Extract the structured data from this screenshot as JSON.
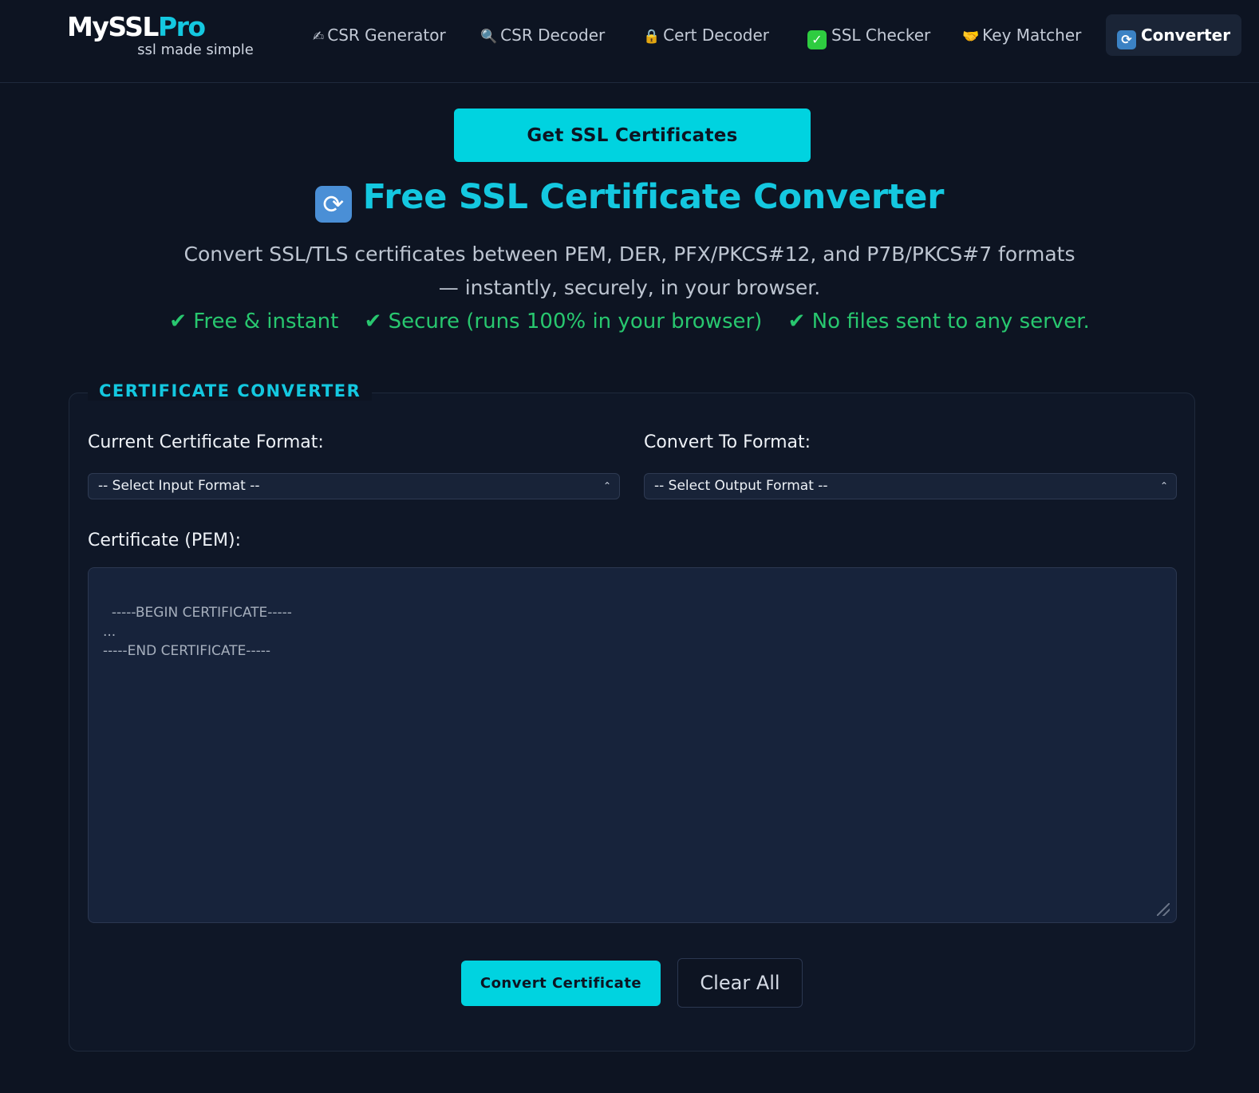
{
  "brand": {
    "name_part1": "MySSL",
    "name_part2": "Pro",
    "tagline": "ssl made simple"
  },
  "nav": {
    "items": [
      {
        "icon": "✍",
        "label": "CSR Generator"
      },
      {
        "icon": "🔍",
        "label": "CSR Decoder"
      },
      {
        "icon": "🔒",
        "label": "Cert Decoder"
      },
      {
        "icon": "✓",
        "label": "SSL Checker"
      },
      {
        "icon": "🤝",
        "label": "Key Matcher"
      },
      {
        "icon": "⟳",
        "label": "Converter",
        "active": true
      }
    ]
  },
  "cta": {
    "label": "Get SSL Certificates"
  },
  "hero": {
    "icon": "⟳",
    "title": "Free SSL Certificate Converter",
    "subtitle": "Convert SSL/TLS certificates between PEM, DER, PFX/PKCS#12, and P7B/PKCS#7 formats — instantly, securely, in your browser.",
    "badges": [
      "✔ Free & instant",
      "✔ Secure (runs 100% in your browser)",
      "✔ No files sent to any server."
    ]
  },
  "converter": {
    "legend": "CERTIFICATE CONVERTER",
    "input_format_label": "Current Certificate Format:",
    "input_format_value": "-- Select Input Format --",
    "output_format_label": "Convert To Format:",
    "output_format_value": "-- Select Output Format --",
    "certificate_label": "Certificate (PEM):",
    "certificate_placeholder": "-----BEGIN CERTIFICATE-----\n...\n-----END CERTIFICATE-----",
    "convert_button": "Convert Certificate",
    "clear_button": "Clear All"
  },
  "colors": {
    "accent": "#00d3e0",
    "success": "#28c76f",
    "background": "#0d1422"
  }
}
